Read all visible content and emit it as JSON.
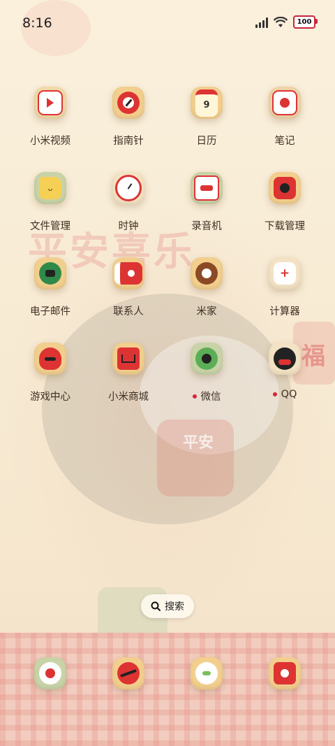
{
  "status_bar": {
    "time": "8:16",
    "battery": "100",
    "icons": [
      "signal-icon",
      "wifi-icon",
      "battery-icon"
    ]
  },
  "background": {
    "title_text": "平安喜乐",
    "bib_text": "平安",
    "seal_text": "福"
  },
  "apps": [
    {
      "label": "小米视频",
      "icon": "video-icon"
    },
    {
      "label": "指南针",
      "icon": "compass-icon"
    },
    {
      "label": "日历",
      "icon": "calendar-icon",
      "icon_text": "9"
    },
    {
      "label": "笔记",
      "icon": "notes-icon"
    },
    {
      "label": "文件管理",
      "icon": "folder-icon"
    },
    {
      "label": "时钟",
      "icon": "clock-icon"
    },
    {
      "label": "录音机",
      "icon": "recorder-icon"
    },
    {
      "label": "下载管理",
      "icon": "download-icon"
    },
    {
      "label": "电子邮件",
      "icon": "email-icon"
    },
    {
      "label": "联系人",
      "icon": "contacts-icon"
    },
    {
      "label": "米家",
      "icon": "mijia-icon"
    },
    {
      "label": "计算器",
      "icon": "calculator-icon"
    },
    {
      "label": "游戏中心",
      "icon": "game-center-icon"
    },
    {
      "label": "小米商城",
      "icon": "mi-store-icon"
    },
    {
      "label": "微信",
      "icon": "wechat-icon",
      "badge": true
    },
    {
      "label": "QQ",
      "icon": "qq-icon",
      "badge": true
    }
  ],
  "search": {
    "label": "搜索",
    "icon": "search-icon"
  },
  "dock": [
    {
      "icon": "phone-icon"
    },
    {
      "icon": "browser-icon"
    },
    {
      "icon": "messages-icon"
    },
    {
      "icon": "camera-icon"
    }
  ],
  "colors": {
    "accent_red": "#d7263b",
    "label_text": "#3f2f23",
    "background": "#f8ecd6"
  }
}
